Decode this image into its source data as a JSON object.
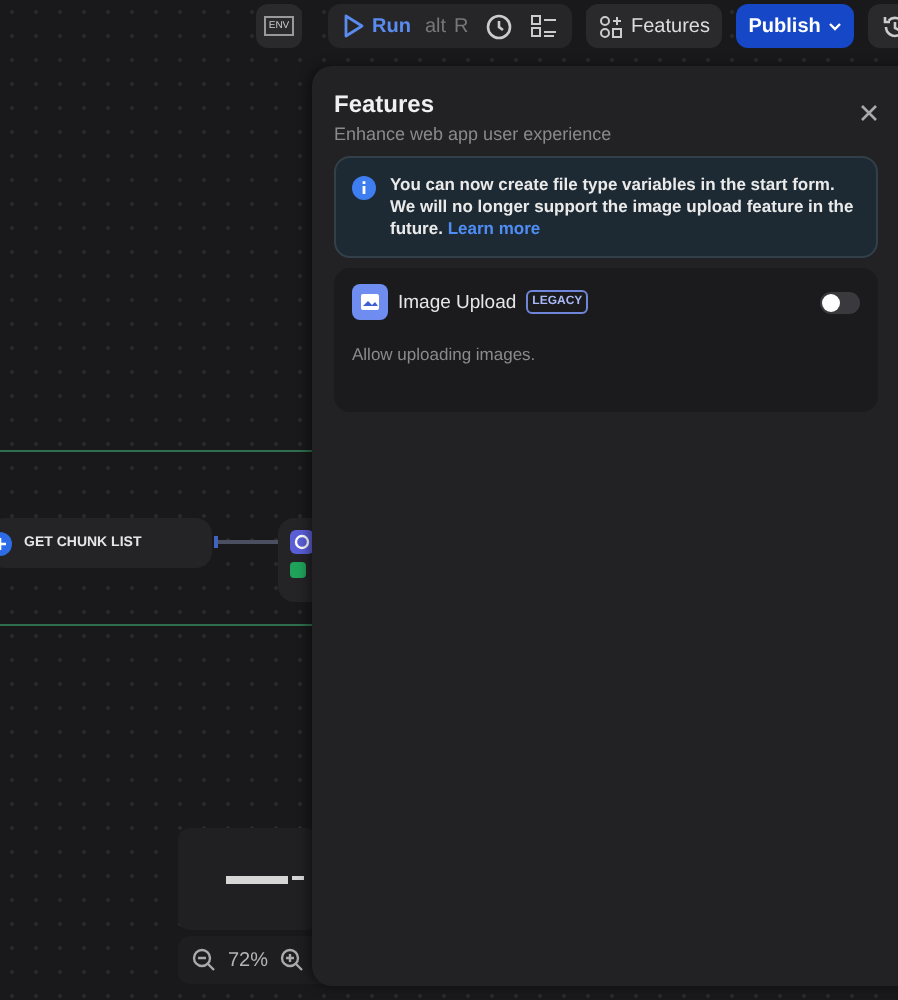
{
  "toolbar": {
    "env_label": "ENV",
    "run": {
      "label": "Run",
      "shortcut": [
        "alt",
        "R"
      ]
    },
    "features_button": "Features",
    "publish_button": "Publish"
  },
  "canvas": {
    "node_title": "GET CHUNK LIST",
    "zoom": "72%"
  },
  "panel": {
    "title": "Features",
    "subtitle": "Enhance web app user experience",
    "notice": {
      "text": "You can now create file type variables in the start form. We will no longer support the image upload feature in the future.",
      "link": "Learn more"
    },
    "features": [
      {
        "name": "Image Upload",
        "badge": "LEGACY",
        "description": "Allow uploading images.",
        "on": false
      }
    ]
  }
}
